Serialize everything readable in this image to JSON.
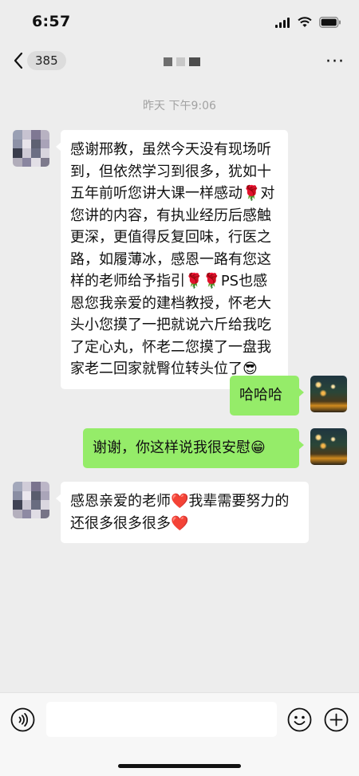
{
  "status_bar": {
    "time": "6:57"
  },
  "nav": {
    "unread_count": "385",
    "more": "···"
  },
  "timestamp": "昨天 下午9:06",
  "messages": [
    {
      "text": "感谢邢教，虽然今天没有现场听到，但依然学习到很多，犹如十五年前听您讲大课一样感动🌹对您讲的内容，有执业经历后感触更深，更值得反复回味，行医之路，如履薄冰，感恩一路有您这样的老师给予指引🌹🌹PS也感恩您我亲爱的建档教授，怀老大头小您摸了一把就说六斤给我吃了定心丸，怀老二您摸了一盘我家老二回家就臀位转头位了😎"
    },
    {
      "text": "哈哈哈"
    },
    {
      "text": "谢谢，你这样说我很安慰😁"
    },
    {
      "text": "感恩亲爱的老师❤️我辈需要努力的还很多很多很多❤️"
    }
  ],
  "input": {
    "placeholder": ""
  },
  "icons": [
    "back-chevron-icon",
    "more-icon",
    "voice-icon",
    "emoji-icon",
    "plus-icon",
    "signal-icon",
    "wifi-icon",
    "battery-icon"
  ],
  "colors": {
    "background": "#ededed",
    "incoming_bubble": "#ffffff",
    "outgoing_bubble": "#95ec69",
    "timestamp": "#a2a2a2"
  }
}
